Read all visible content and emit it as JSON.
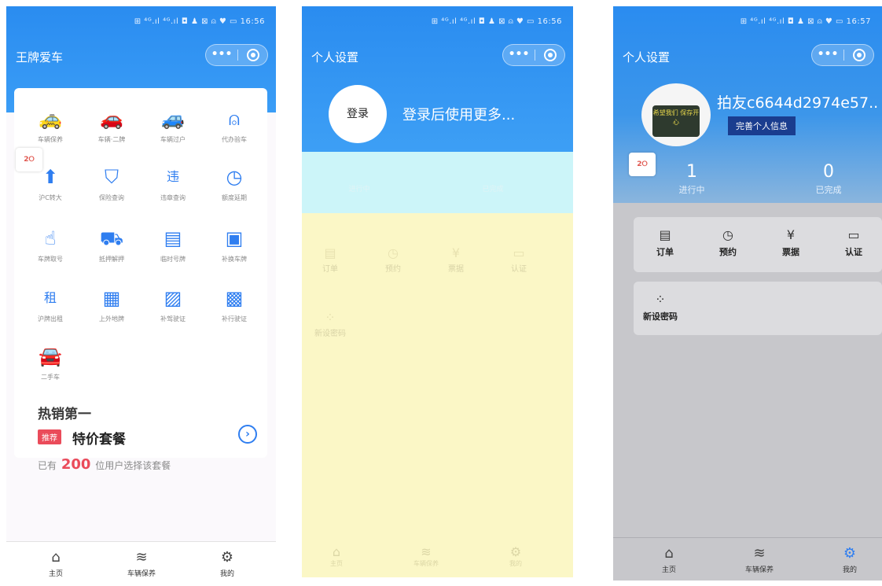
{
  "status_bar": {
    "p1_time": "16:56",
    "p2_time": "16:56",
    "p3_time": "16:57",
    "signal": "⊞ ⁴ᴳ.ıl ⁴ᴳ.ıl ◘ ♟ ⊠ ⍝ ♥ ▭"
  },
  "phone1": {
    "title": "王牌爱车",
    "grid": [
      {
        "label": "车辆保养",
        "icon": "car-front-icon",
        "glyph": "🚕"
      },
      {
        "label": "车辆·二牌",
        "icon": "car-gear-icon",
        "glyph": "🚗"
      },
      {
        "label": "车辆过户",
        "icon": "car-transfer-icon",
        "glyph": "🚙"
      },
      {
        "label": "代办验车",
        "icon": "person-icon",
        "glyph": "⍝"
      },
      {
        "label": "沪C转大",
        "icon": "up-arrow-icon",
        "glyph": "⬆"
      },
      {
        "label": "保险查询",
        "icon": "shield-icon",
        "glyph": "⛉"
      },
      {
        "label": "违章查询",
        "icon": "violation-icon",
        "glyph": "违"
      },
      {
        "label": "额度延期",
        "icon": "clock-icon",
        "glyph": "◷"
      },
      {
        "label": "车牌取号",
        "icon": "hand-tap-icon",
        "glyph": "☝"
      },
      {
        "label": "抵押解押",
        "icon": "car-mortgage-icon",
        "glyph": "⛟"
      },
      {
        "label": "临时号牌",
        "icon": "temp-plate-icon",
        "glyph": "▤"
      },
      {
        "label": "补换车牌",
        "icon": "plate-icon",
        "glyph": "▣"
      },
      {
        "label": "沪牌出租",
        "icon": "rent-icon",
        "glyph": "租"
      },
      {
        "label": "上外地牌",
        "icon": "plate-frame-icon",
        "glyph": "▦"
      },
      {
        "label": "补驾驶证",
        "icon": "license-icon",
        "glyph": "▨"
      },
      {
        "label": "补行驶证",
        "icon": "card-check-icon",
        "glyph": "▩"
      },
      {
        "label": "二手车",
        "icon": "used-car-icon",
        "glyph": "🚘"
      }
    ],
    "hot_title": "热销第一",
    "tag": "推荐",
    "package": "特价套餐",
    "users_prefix": "已有",
    "users_count": "200",
    "users_suffix": "位用户选择该套餐",
    "sticker": "2⭘"
  },
  "phone2": {
    "title": "个人设置",
    "login_button": "登录",
    "login_hint": "登录后使用更多...",
    "stats": [
      {
        "label": "进行中"
      },
      {
        "label": "已完成"
      }
    ],
    "menu": [
      "订单",
      "预约",
      "票据",
      "认证"
    ],
    "extra": "新设密码",
    "tabs": [
      "主页",
      "车辆保养",
      "我的"
    ]
  },
  "phone3": {
    "title": "个人设置",
    "nickname": "拍友c6644d2974e57..",
    "avatar_text": "希望我们 保存开心",
    "complete_button": "完善个人信息",
    "stats": [
      {
        "value": "1",
        "label": "进行中"
      },
      {
        "value": "0",
        "label": "已完成"
      }
    ],
    "menu": [
      {
        "label": "订单",
        "icon": "order-icon",
        "glyph": "▤"
      },
      {
        "label": "预约",
        "icon": "timer-icon",
        "glyph": "◷"
      },
      {
        "label": "票据",
        "icon": "receipt-icon",
        "glyph": "¥"
      },
      {
        "label": "认证",
        "icon": "id-card-icon",
        "glyph": "▭"
      }
    ],
    "extra": {
      "label": "新设密码",
      "icon": "keypad-icon",
      "glyph": "⁘"
    }
  },
  "tabbar": {
    "home": "主页",
    "service": "车辆保养",
    "mine": "我的"
  }
}
